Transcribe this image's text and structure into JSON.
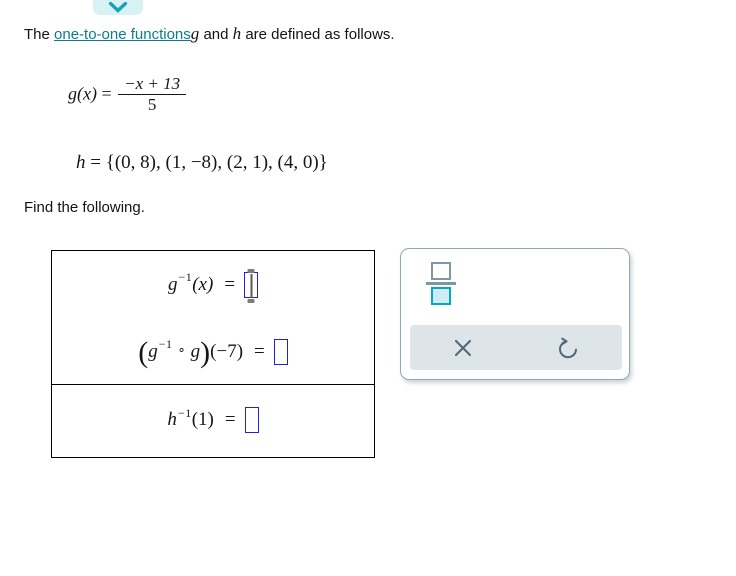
{
  "toolbar": {
    "collapse_chevron_icon": "chevron-down-icon"
  },
  "problem": {
    "stem_prefix": "The ",
    "stem_link": "one-to-one functions",
    "stem_var_1": "g",
    "stem_mid": " and ",
    "stem_var_2": "h",
    "stem_suffix": " are defined as follows.",
    "find_prompt": "Find the following.",
    "g_definition": {
      "lhs_function": "g",
      "lhs_arg": "(x)",
      "equals": "=",
      "numerator": "−x + 13",
      "denominator": "5"
    },
    "h_definition": {
      "lhs_function": "h",
      "equals": "=",
      "set_text": "{(0, 8), (1, −8), (2, 1), (4, 0)}",
      "pairs": [
        [
          0,
          8
        ],
        [
          1,
          -8
        ],
        [
          2,
          1
        ],
        [
          4,
          0
        ]
      ]
    }
  },
  "answers": {
    "rows": [
      {
        "id": "g-inverse-of-x",
        "function": "g",
        "exponent": "−1",
        "argument": "(x)",
        "equals": "=",
        "value": "",
        "focused": true
      },
      {
        "id": "g-inverse-composed-g-at-neg7",
        "open_paren": "(",
        "function": "g",
        "exponent": "−1",
        "ring": "∘",
        "function_2": "g",
        "close_paren": ")",
        "argument": "(−7)",
        "equals": "=",
        "value": "",
        "focused": false
      },
      {
        "id": "h-inverse-of-1",
        "function": "h",
        "exponent": "−1",
        "argument": "(1)",
        "equals": "=",
        "value": "",
        "focused": false
      }
    ]
  },
  "palette": {
    "fraction_key_label": "fraction-template",
    "fraction_key_icon": "fraction-icon",
    "clear_label": "✕",
    "clear_icon": "close-x-icon",
    "undo_label": "↺",
    "undo_icon": "undo-reset-icon"
  },
  "colors": {
    "link": "#0c7c8c",
    "chevron_pill_bg": "#d8f1f5",
    "chevron_teal": "#17a2b8",
    "input_border": "#2020e0",
    "palette_border": "#8fa8b2",
    "palette_footer_bg": "#dde5e8",
    "frac_key_slate": "#7e98a3",
    "frac_key_cyan": "#04a8c4",
    "frac_key_cyan_fill": "#cdecf3",
    "text": "#131313"
  }
}
